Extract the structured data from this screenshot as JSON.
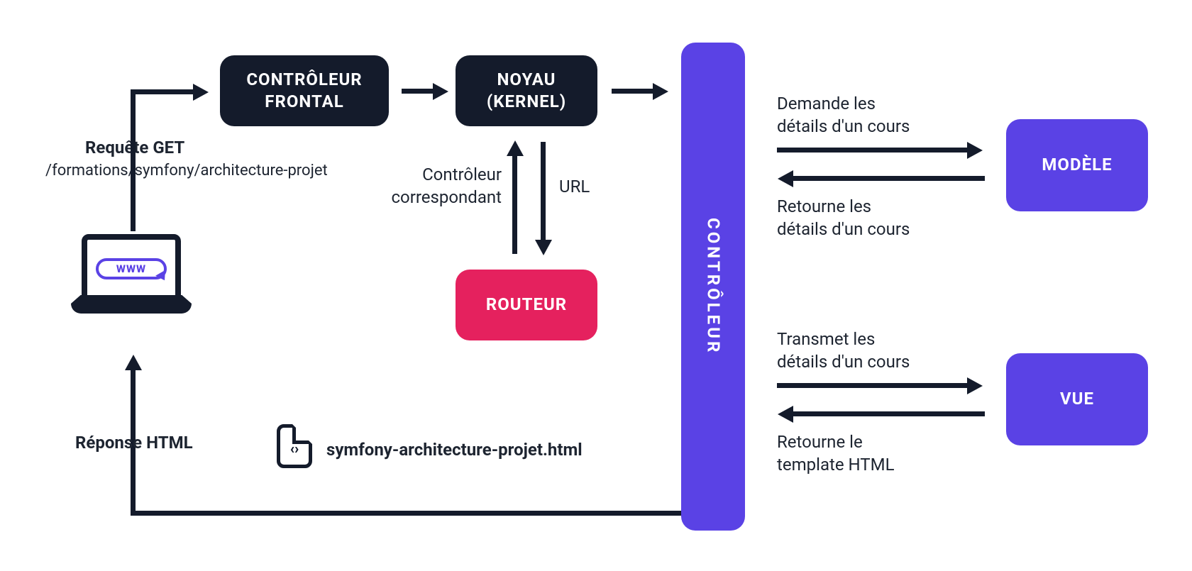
{
  "boxes": {
    "frontController": {
      "line1": "CONTRÔLEUR",
      "line2": "FRONTAL"
    },
    "kernel": {
      "line1": "NOYAU",
      "line2": "(KERNEL)"
    },
    "router": "ROUTEUR",
    "controller": "CONTRÔLEUR",
    "model": "MODÈLE",
    "view": "VUE"
  },
  "labels": {
    "requestTitle": "Requête GET",
    "requestPath": "/formations/symfony/architecture-projet",
    "kernelRouterLeft1": "Contrôleur",
    "kernelRouterLeft2": "correspondant",
    "kernelRouterRight": "URL",
    "responseTitle": "Réponse HTML",
    "fileName": "symfony-architecture-projet.html",
    "modelTop1": "Demande les",
    "modelTop2": "détails d'un cours",
    "modelBottom1": "Retourne les",
    "modelBottom2": "détails d'un cours",
    "viewTop1": "Transmet les",
    "viewTop2": "détails d'un cours",
    "viewBottom1": "Retourne le",
    "viewBottom2": "template HTML"
  },
  "laptopBadge": "WWW"
}
